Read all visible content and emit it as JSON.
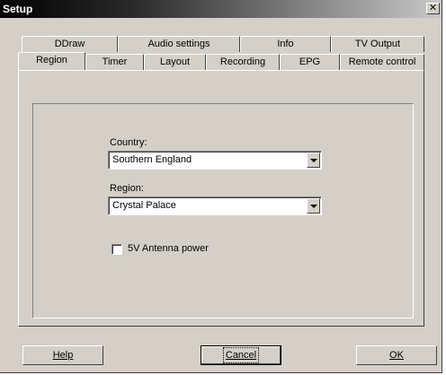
{
  "window": {
    "title": "Setup",
    "close_glyph": "✕"
  },
  "tabs_back": [
    "DDraw",
    "Audio settings",
    "Info",
    "TV Output"
  ],
  "tabs_front": [
    "Region",
    "Timer",
    "Layout",
    "Recording",
    "EPG",
    "Remote control"
  ],
  "active_tab": "Region",
  "form": {
    "country_label": "Country:",
    "country_value": "Southern England",
    "region_label": "Region:",
    "region_value": "Crystal Palace",
    "antenna_label": "5V Antenna power",
    "antenna_checked": false
  },
  "buttons": {
    "help": "Help",
    "cancel": "Cancel",
    "ok": "OK"
  },
  "colors": {
    "face": "#d4d0c8",
    "titlebar_start": "#000000"
  }
}
